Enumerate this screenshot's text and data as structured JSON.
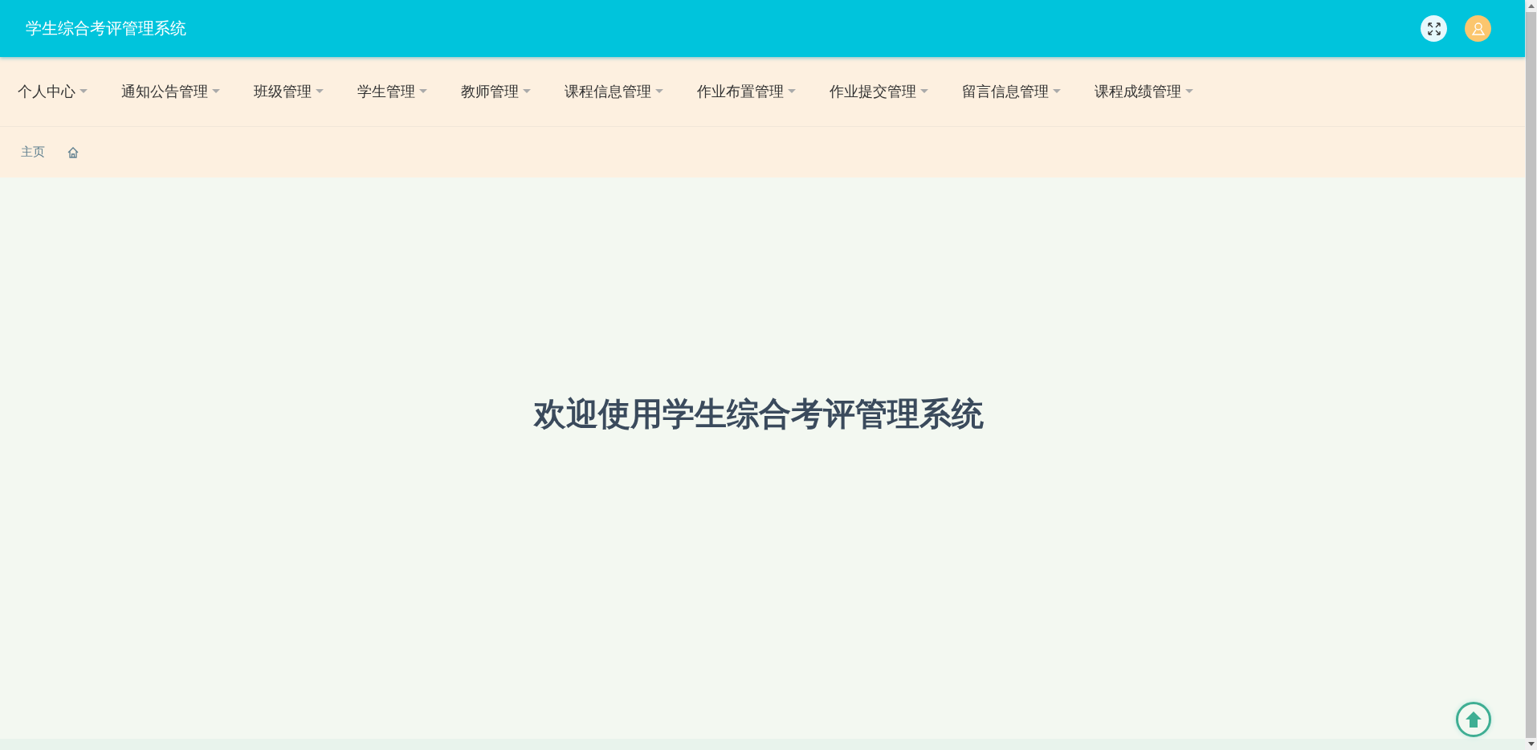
{
  "header": {
    "title": "学生综合考评管理系统"
  },
  "menu": [
    {
      "label": "个人中心"
    },
    {
      "label": "通知公告管理"
    },
    {
      "label": "班级管理"
    },
    {
      "label": "学生管理"
    },
    {
      "label": "教师管理"
    },
    {
      "label": "课程信息管理"
    },
    {
      "label": "作业布置管理"
    },
    {
      "label": "作业提交管理"
    },
    {
      "label": "留言信息管理"
    },
    {
      "label": "课程成绩管理"
    }
  ],
  "breadcrumb": {
    "label": "主页"
  },
  "welcome": "欢迎使用学生综合考评管理系统"
}
